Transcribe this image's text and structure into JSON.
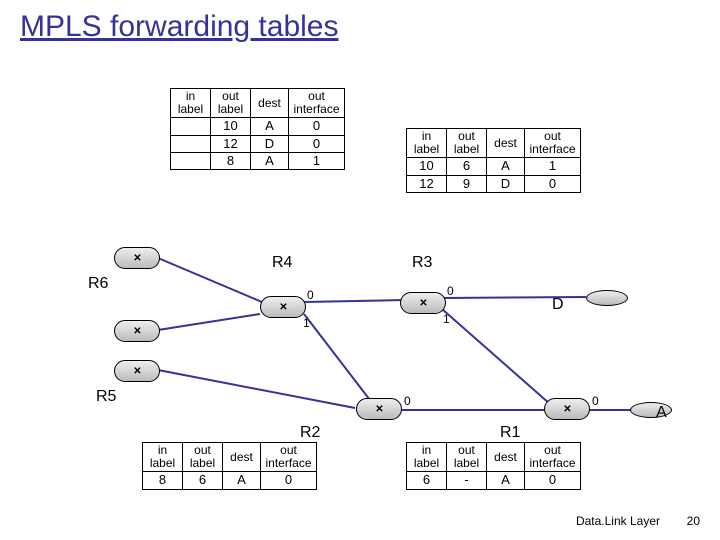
{
  "title": "MPLS forwarding tables",
  "footer": "Data.Link Layer",
  "pagenum": "20",
  "headers": {
    "in_label": "in\nlabel",
    "out_label": "out\nlabel",
    "dest": "dest",
    "out_if": "out\ninterface"
  },
  "routers": {
    "r6_label": "R6",
    "r5_label": "R5",
    "r4_label": "R4",
    "r3_label": "R3",
    "r2_label": "R2",
    "r1_label": "R1",
    "destD": "D",
    "destA": "A"
  },
  "ports": {
    "r4_p0": "0",
    "r4_p1": "1",
    "r3_p0": "0",
    "r3_p1": "1",
    "r2_p0": "0",
    "r1_p0": "0"
  },
  "tbl_r4": [
    {
      "in": "",
      "out": "10",
      "dest": "A",
      "if": "0"
    },
    {
      "in": "",
      "out": "12",
      "dest": "D",
      "if": "0"
    },
    {
      "in": "",
      "out": "8",
      "dest": "A",
      "if": "1"
    }
  ],
  "tbl_r3": [
    {
      "in": "10",
      "out": "6",
      "dest": "A",
      "if": "1"
    },
    {
      "in": "12",
      "out": "9",
      "dest": "D",
      "if": "0"
    }
  ],
  "tbl_r2": [
    {
      "in": "8",
      "out": "6",
      "dest": "A",
      "if": "0"
    }
  ],
  "tbl_r1": [
    {
      "in": "6",
      "out": "-",
      "dest": "A",
      "if": "0"
    }
  ]
}
